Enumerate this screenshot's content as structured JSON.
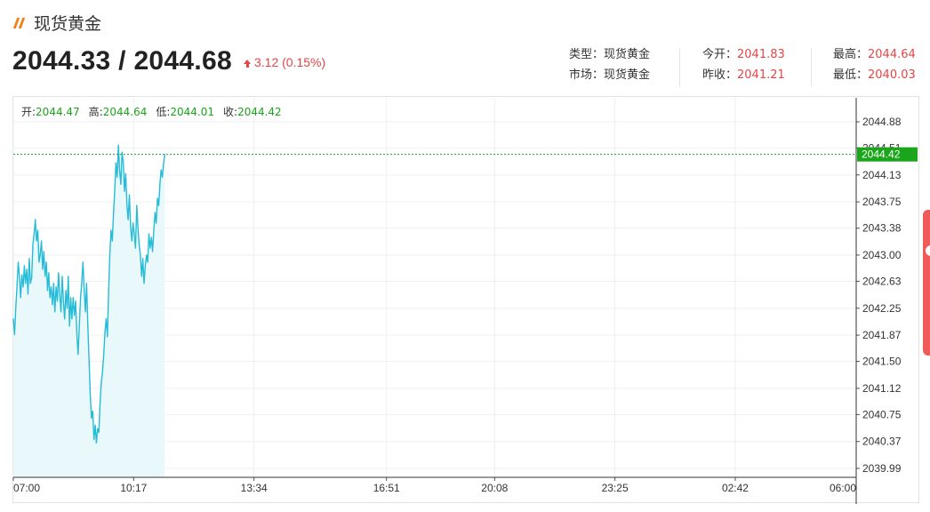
{
  "header": {
    "title": "现货黄金",
    "icon": "double-slash-icon",
    "price": "2044.33 / 2044.68",
    "change": "3.12 (0.15%)",
    "change_direction": "up",
    "accent_color": "#f0801a",
    "up_color": "#e64545"
  },
  "info": {
    "type_label": "类型：",
    "type_value": "现货黄金",
    "market_label": "市场：",
    "market_value": "现货黄金",
    "open_label": "今开：",
    "open_value": "2041.83",
    "prev_close_label": "昨收：",
    "prev_close_value": "2041.21",
    "high_label": "最高：",
    "high_value": "2044.64",
    "low_label": "最低：",
    "low_value": "2040.03"
  },
  "ohlc_legend": {
    "open_label": "开:",
    "open_value": "2044.47",
    "high_label": "高:",
    "high_value": "2044.64",
    "low_label": "低:",
    "low_value": "2044.01",
    "close_label": "收:",
    "close_value": "2044.42"
  },
  "chart_data": {
    "type": "area",
    "line_color": "#26bcd7",
    "fill_color": "#e8f8fb",
    "current_price_color": "#1aa51a",
    "grid": true,
    "x_range": [
      "07:00",
      "06:00"
    ],
    "x_ticks": [
      "07:00",
      "10:17",
      "13:34",
      "16:51",
      "20:08",
      "23:25",
      "02:42",
      "06:00"
    ],
    "x_tick_minutes": [
      0,
      197,
      394,
      611,
      788,
      985,
      1182,
      1380
    ],
    "y_ticks": [
      "2044.88",
      "2044.51",
      "2044.13",
      "2043.75",
      "2043.38",
      "2043.00",
      "2042.63",
      "2042.25",
      "2041.87",
      "2041.50",
      "2041.12",
      "2040.75",
      "2040.37",
      "2039.99"
    ],
    "ylim": [
      2039.99,
      2044.88
    ],
    "current_price": "2044.42",
    "series": [
      {
        "x_minutes": [
          0,
          2,
          4,
          6,
          8,
          10,
          12,
          14,
          16,
          18,
          20,
          22,
          24,
          26,
          28,
          30,
          32,
          34,
          36,
          38,
          40,
          42,
          44,
          46,
          48,
          50,
          52,
          54,
          56,
          58,
          60,
          62,
          64,
          66,
          68,
          70,
          72,
          74,
          76,
          78,
          80,
          82,
          84,
          86,
          88,
          90,
          92,
          94,
          96,
          98,
          100,
          102,
          104,
          106,
          108,
          110,
          112,
          114,
          116,
          118,
          120,
          122,
          124,
          126,
          128,
          130,
          132,
          134,
          136,
          138,
          140,
          142,
          144,
          146,
          148,
          150,
          152,
          154,
          156,
          158,
          160,
          162,
          164,
          166,
          168,
          170,
          172,
          174,
          176,
          178,
          180,
          182,
          184,
          186,
          188,
          190,
          192,
          194,
          196,
          198,
          200,
          202,
          204,
          206,
          208,
          210,
          212,
          214,
          216,
          218,
          220,
          222,
          224,
          226,
          228,
          230,
          232,
          234,
          236,
          238,
          240,
          242,
          244,
          246,
          248
        ],
        "values": [
          2042.1,
          2041.88,
          2042.25,
          2042.55,
          2042.9,
          2042.7,
          2042.4,
          2042.72,
          2042.55,
          2042.85,
          2042.6,
          2042.8,
          2042.45,
          2042.95,
          2042.6,
          2042.68,
          2043.15,
          2043.3,
          2043.5,
          2043.2,
          2043.35,
          2042.9,
          2043.0,
          2043.2,
          2042.8,
          2043.05,
          2042.7,
          2042.9,
          2042.5,
          2042.75,
          2042.4,
          2042.55,
          2042.3,
          2042.6,
          2042.2,
          2042.55,
          2042.35,
          2042.75,
          2042.45,
          2042.2,
          2042.7,
          2042.35,
          2042.1,
          2042.5,
          2042.25,
          2042.7,
          2042.0,
          2042.4,
          2042.1,
          2042.4,
          2042.15,
          2042.35,
          2041.9,
          2041.6,
          2042.0,
          2042.4,
          2042.6,
          2042.9,
          2042.5,
          2042.2,
          2042.6,
          2042.0,
          2041.5,
          2041.0,
          2040.7,
          2040.8,
          2040.4,
          2040.6,
          2040.35,
          2040.55,
          2040.5,
          2040.9,
          2041.2,
          2041.35,
          2041.6,
          2041.9,
          2042.1,
          2041.85,
          2042.5,
          2043.0,
          2043.35,
          2043.2,
          2043.6,
          2043.9,
          2044.3,
          2044.1,
          2044.55,
          2044.2,
          2044.0,
          2044.45,
          2044.3,
          2043.9,
          2044.15,
          2043.7,
          2043.5,
          2043.85,
          2043.4,
          2043.2,
          2043.45,
          2043.3,
          2043.1,
          2043.7,
          2043.4,
          2043.15,
          2043.0,
          2042.7,
          2042.95,
          2042.6,
          2042.85,
          2043.0,
          2042.9,
          2043.3,
          2043.1,
          2043.25,
          2043.05,
          2043.35,
          2043.6,
          2043.45,
          2043.8,
          2043.7,
          2044.0,
          2044.2,
          2044.1,
          2044.3,
          2044.42
        ]
      }
    ]
  }
}
